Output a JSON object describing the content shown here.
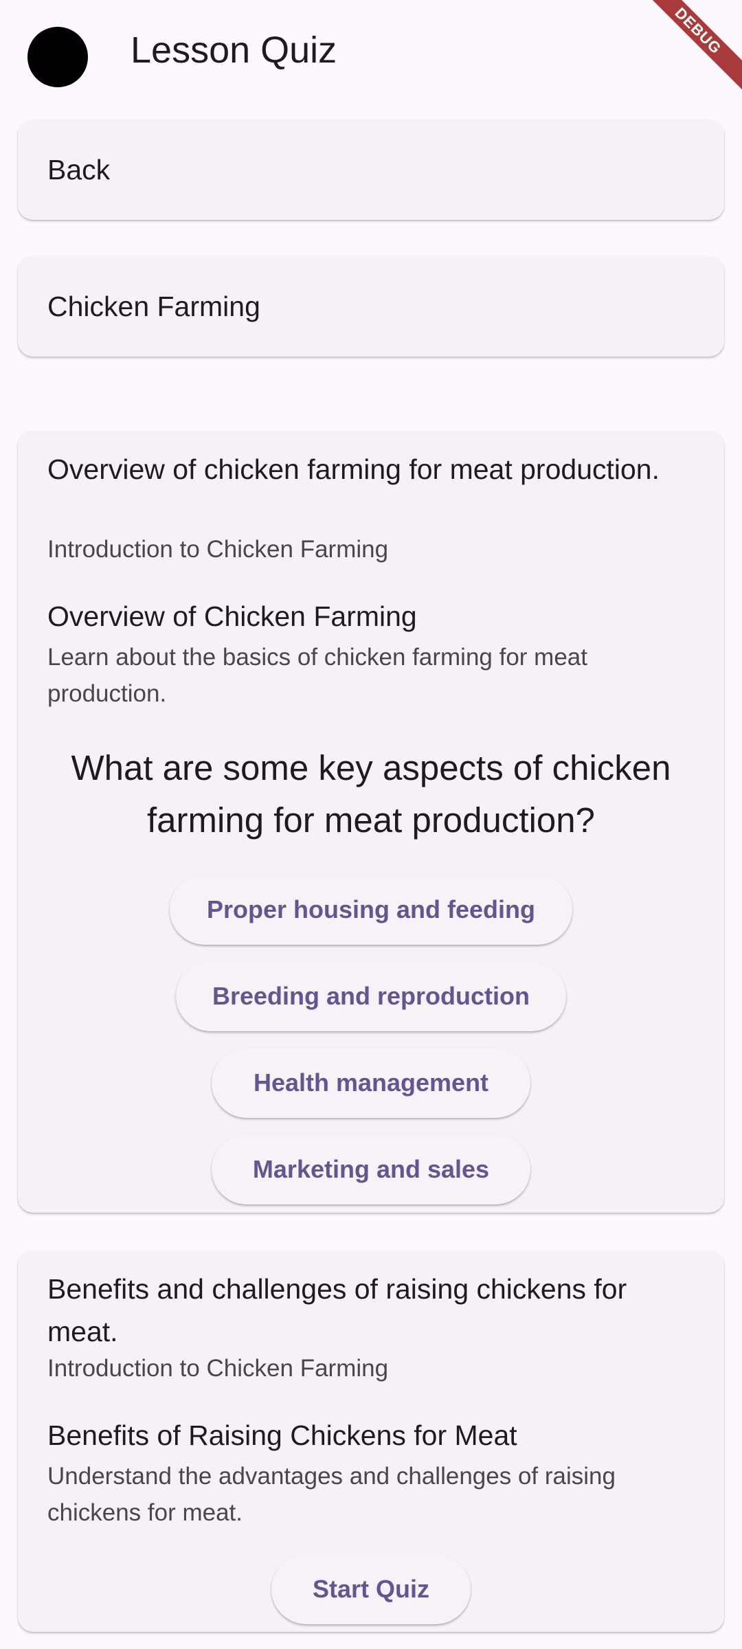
{
  "app_bar": {
    "title": "Lesson Quiz"
  },
  "debug_banner": "DEBUG",
  "back_tile": {
    "label": "Back"
  },
  "topic_tile": {
    "label": "Chicken Farming"
  },
  "lessons": [
    {
      "title": "Overview of chicken farming for meat production.",
      "subtitle": "Introduction to Chicken Farming",
      "section_title": "Overview of Chicken Farming",
      "section_description": "Learn about the basics of chicken farming for meat production.",
      "question": "What are some key aspects of chicken farming for meat production?",
      "options": [
        "Proper housing and feeding",
        "Breeding and reproduction",
        "Health management",
        "Marketing and sales"
      ]
    },
    {
      "title": "Benefits and challenges of raising chickens for meat.",
      "subtitle": "Introduction to Chicken Farming",
      "section_title": "Benefits of Raising Chickens for Meat",
      "section_description": "Understand the advantages and challenges of raising chickens for meat.",
      "start_button": "Start Quiz"
    }
  ],
  "colors": {
    "background": "#fdf7fe",
    "card": "#f6f0f7",
    "accent": "#65558f",
    "debug_banner": "#a83b3b"
  }
}
